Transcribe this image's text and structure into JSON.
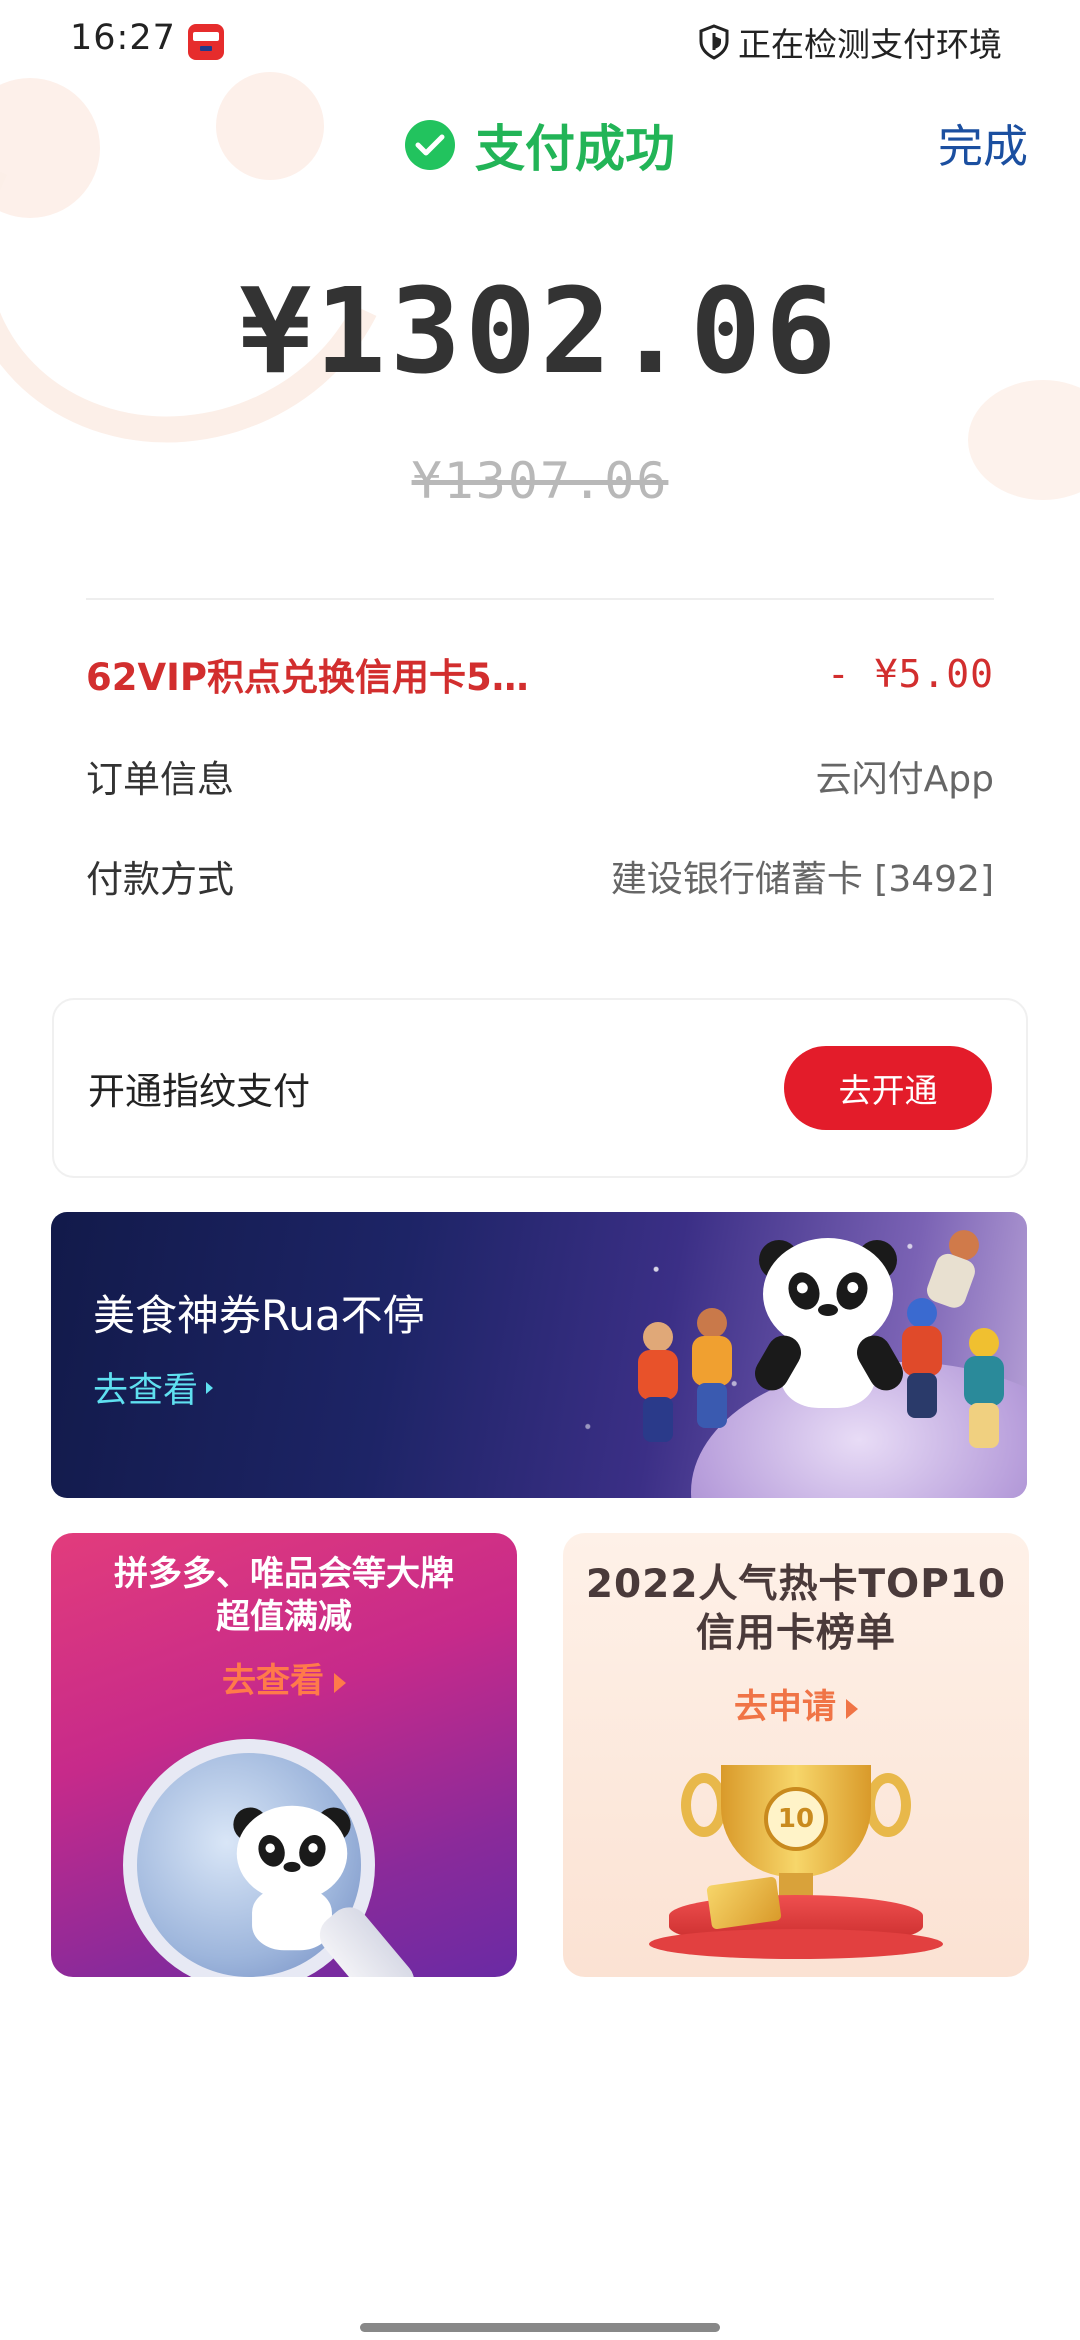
{
  "status_bar": {
    "time": "16:27",
    "security_text": "正在检测支付环境"
  },
  "header": {
    "title": "支付成功",
    "done_label": "完成"
  },
  "payment": {
    "amount_paid": "¥1302.06",
    "amount_original": "¥1307.06"
  },
  "details": {
    "promo": {
      "label": "62VIP积点兑换信用卡5…",
      "value": "- ¥5.00"
    },
    "rows": [
      {
        "label": "订单信息",
        "value": "云闪付App"
      },
      {
        "label": "付款方式",
        "value": "建设银行储蓄卡 [3492]"
      }
    ]
  },
  "fingerprint": {
    "label": "开通指纹支付",
    "button_label": "去开通"
  },
  "banner": {
    "title": "美食神券Rua不停",
    "link_label": "去查看"
  },
  "tiles": [
    {
      "title_line1": "拼多多、唯品会等大牌",
      "title_line2": "超值满减",
      "link_label": "去查看"
    },
    {
      "title_line1": "2022人气热卡TOP10",
      "title_line2": "信用卡榜单",
      "link_label": "去申请",
      "medal_text": "10"
    }
  ],
  "colors": {
    "success_green": "#22b457",
    "done_blue": "#1b4fa0",
    "promo_red": "#d22e2e",
    "button_red": "#e31c2a"
  },
  "icons": {
    "status_app": "app-logo-icon",
    "security": "shield-icon",
    "success": "check-circle-icon"
  }
}
